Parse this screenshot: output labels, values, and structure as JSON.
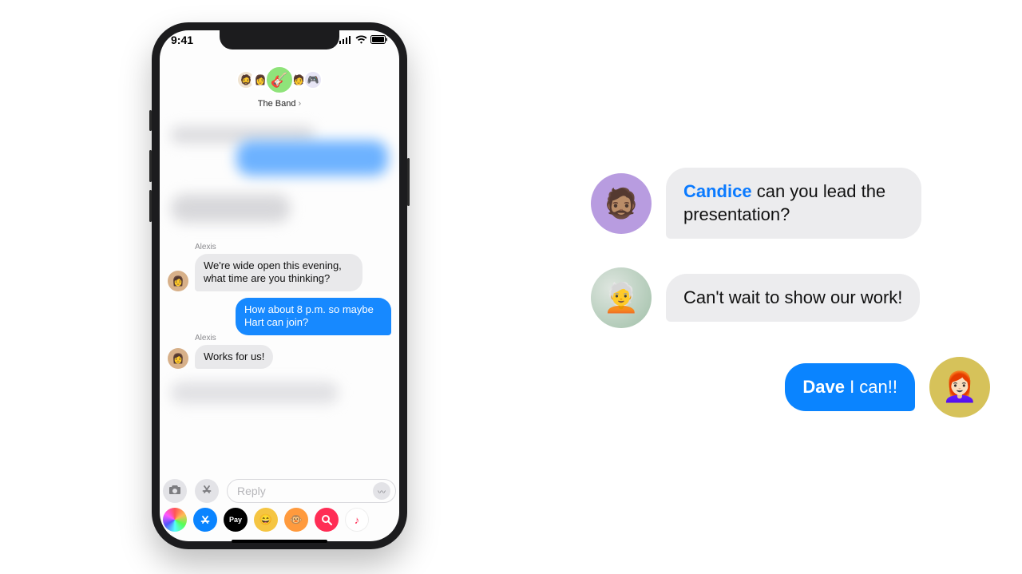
{
  "status": {
    "time": "9:41"
  },
  "header": {
    "group_name": "The Band",
    "chevron": "›"
  },
  "phone_messages": {
    "m1_sender": "Alexis",
    "m1_text": "We're wide open this evening, what time are you thinking?",
    "m2_text": "How about 8 p.m. so maybe Hart can join?",
    "m3_sender": "Alexis",
    "m3_text": "Works for us!"
  },
  "input": {
    "placeholder": "Reply"
  },
  "app_drawer": {
    "photos": "photos-icon",
    "appstore": "appstore-icon",
    "applepay_label": "Pay",
    "memoji": "memoji-icon",
    "stickers": "stickers-icon",
    "search": "search-icon",
    "music": "music-icon"
  },
  "big_chat": {
    "b1_mention": "Candice",
    "b1_text": " can you lead the presentation?",
    "b2_text": "Can't wait to show our work!",
    "b3_mention": "Dave",
    "b3_text": " I can!!"
  },
  "colors": {
    "imessage_blue": "#0a84ff",
    "bubble_gray": "#ececee"
  }
}
